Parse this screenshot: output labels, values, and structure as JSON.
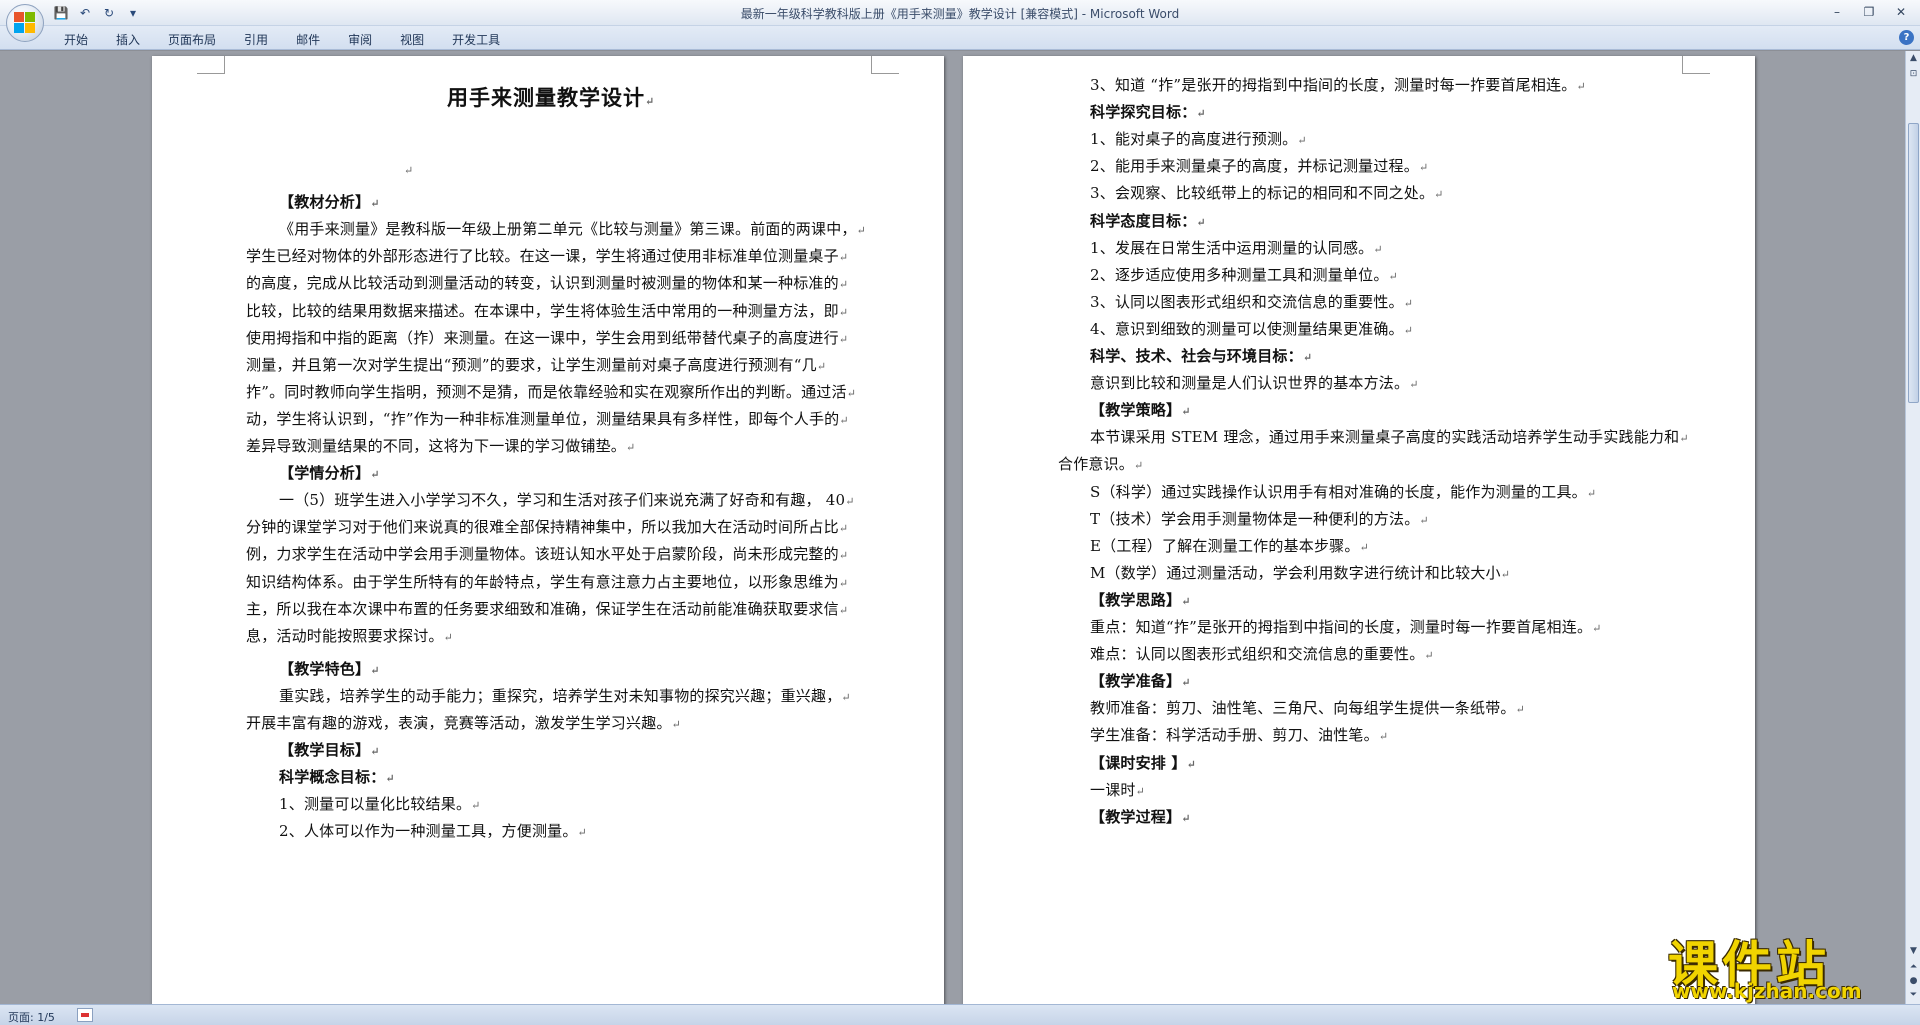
{
  "window": {
    "title": "最新一年级科学教科版上册《用手来测量》教学设计 [兼容模式] - Microsoft Word",
    "minimize": "–",
    "restore": "❐",
    "close": "✕"
  },
  "quick_access": {
    "save": "💾",
    "undo": "↶",
    "redo": "↻",
    "more": "▾"
  },
  "ribbon": {
    "tabs": [
      "开始",
      "插入",
      "页面布局",
      "引用",
      "邮件",
      "审阅",
      "视图",
      "开发工具"
    ],
    "help": "?"
  },
  "page_left": {
    "title": "用手来测量教学设计",
    "lines": [
      {
        "text": "",
        "bold": false
      },
      {
        "text": "【教材分析】",
        "bold": true
      },
      {
        "text": "《用手来测量》是教科版一年级上册第二单元《比较与测量》第三课。前面的两课中，",
        "bold": false
      },
      {
        "text": "学生已经对物体的外部形态进行了比较。在这一课，学生将通过使用非标准单位测量桌子",
        "bold": false
      },
      {
        "text": "的高度，完成从比较活动到测量活动的转变，认识到测量时被测量的物体和某一种标准的",
        "bold": false
      },
      {
        "text": "比较，比较的结果用数据来描述。在本课中，学生将体验生活中常用的一种测量方法，即",
        "bold": false
      },
      {
        "text": "使用拇指和中指的距离（拃）来测量。在这一课中，学生会用到纸带替代桌子的高度进行",
        "bold": false
      },
      {
        "text": "测量，并且第一次对学生提出“预测”的要求，让学生测量前对桌子高度进行预测有“几",
        "bold": false
      },
      {
        "text": "拃”。同时教师向学生指明，预测不是猜，而是依靠经验和实在观察所作出的判断。通过活",
        "bold": false
      },
      {
        "text": "动，学生将认识到，“拃”作为一种非标准测量单位，测量结果具有多样性，即每个人手的",
        "bold": false
      },
      {
        "text": "差异导致测量结果的不同，这将为下一课的学习做铺垫。",
        "bold": false
      },
      {
        "text": "【学情分析】",
        "bold": true
      },
      {
        "text": "一（5）班学生进入小学学习不久，学习和生活对孩子们来说充满了好奇和有趣，  40",
        "bold": false
      },
      {
        "text": "分钟的课堂学习对于他们来说真的很难全部保持精神集中，所以我加大在活动时间所占比",
        "bold": false
      },
      {
        "text": "例，力求学生在活动中学会用手测量物体。该班认知水平处于启蒙阶段，尚未形成完整的",
        "bold": false
      },
      {
        "text": "知识结构体系。由于学生所特有的年龄特点，学生有意注意力占主要地位，以形象思维为",
        "bold": false
      },
      {
        "text": "主，所以我在本次课中布置的任务要求细致和准确，保证学生在活动前能准确获取要求信",
        "bold": false
      },
      {
        "text": "息，活动时能按照要求探讨。",
        "bold": false
      },
      {
        "text": "【教学特色】",
        "bold": true
      },
      {
        "text": "重实践，培养学生的动手能力；重探究，培养学生对未知事物的探究兴趣；重兴趣，",
        "bold": false
      },
      {
        "text": "开展丰富有趣的游戏，表演，竞赛等活动，激发学生学习兴趣。",
        "bold": false
      },
      {
        "text": "【教学目标】",
        "bold": true
      },
      {
        "text": "科学概念目标：",
        "bold": true
      },
      {
        "text": "1、测量可以量化比较结果。",
        "bold": false
      },
      {
        "text": "2、人体可以作为一种测量工具，方便测量。",
        "bold": false
      }
    ]
  },
  "page_right": {
    "lines": [
      {
        "text": "3、知道 “拃”是张开的拇指到中指间的长度，测量时每一拃要首尾相连。",
        "bold": false
      },
      {
        "text": "科学探究目标：",
        "bold": true
      },
      {
        "text": "1、能对桌子的高度进行预测。",
        "bold": false
      },
      {
        "text": "2、能用手来测量桌子的高度，并标记测量过程。",
        "bold": false
      },
      {
        "text": "3、会观察、比较纸带上的标记的相同和不同之处。",
        "bold": false
      },
      {
        "text": "科学态度目标：",
        "bold": true
      },
      {
        "text": "1、发展在日常生活中运用测量的认同感。",
        "bold": false
      },
      {
        "text": "2、逐步适应使用多种测量工具和测量单位。",
        "bold": false
      },
      {
        "text": "3、认同以图表形式组织和交流信息的重要性。",
        "bold": false
      },
      {
        "text": "4、意识到细致的测量可以使测量结果更准确。",
        "bold": false
      },
      {
        "text": "科学、技术、社会与环境目标：",
        "bold": true
      },
      {
        "text": "意识到比较和测量是人们认识世界的基本方法。",
        "bold": false
      },
      {
        "text": "【教学策略】",
        "bold": true
      },
      {
        "text": "本节课采用 STEM 理念，通过用手来测量桌子高度的实践活动培养学生动手实践能力和",
        "bold": false
      },
      {
        "text": "合作意识。",
        "bold": false
      },
      {
        "text": "S（科学）通过实践操作认识用手有相对准确的长度，能作为测量的工具。",
        "bold": false
      },
      {
        "text": "T（技术）学会用手测量物体是一种便利的方法。",
        "bold": false
      },
      {
        "text": "E（工程）了解在测量工作的基本步骤。",
        "bold": false
      },
      {
        "text": "M（数学）通过测量活动，学会利用数字进行统计和比较大小",
        "bold": false
      },
      {
        "text": "【教学思路】",
        "bold": true
      },
      {
        "text": "重点：知道“拃”是张开的拇指到中指间的长度，测量时每一拃要首尾相连。",
        "bold": false
      },
      {
        "text": "难点：认同以图表形式组织和交流信息的重要性。",
        "bold": false
      },
      {
        "text": "【教学准备】",
        "bold": true
      },
      {
        "text": "教师准备：剪刀、油性笔、三角尺、向每组学生提供一条纸带。",
        "bold": false
      },
      {
        "text": "学生准备：科学活动手册、剪刀、油性笔。",
        "bold": false
      },
      {
        "text": "【课时安排 】",
        "bold": true
      },
      {
        "text": "一课时",
        "bold": false
      },
      {
        "text": "【教学过程】",
        "bold": true
      }
    ]
  },
  "paragraph_mark": "↵",
  "statusbar": {
    "page": "页面: 1/5"
  },
  "watermark": {
    "name": "课件站",
    "url": "www.kjzhan.com"
  }
}
